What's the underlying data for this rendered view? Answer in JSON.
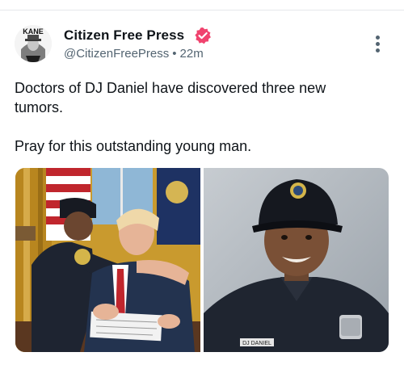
{
  "post": {
    "author": {
      "display_name": "Citizen Free Press",
      "handle": "@CitizenFreePress",
      "separator": "•",
      "timestamp": "22m",
      "avatar_text": "KANE",
      "verified_icon": "verified-badge-icon",
      "verified_color": "#f0436e"
    },
    "more_icon": "more-vertical-icon",
    "text": {
      "line1": "Doctors of DJ Daniel have discovered three new tumors.",
      "line2": "Pray for this outstanding young man."
    },
    "media": {
      "count": 2,
      "right_photo_nameplate": "DJ DANIEL"
    }
  },
  "colors": {
    "text_primary": "#0f1419",
    "text_secondary": "#536471",
    "border": "#e6e8eb"
  }
}
